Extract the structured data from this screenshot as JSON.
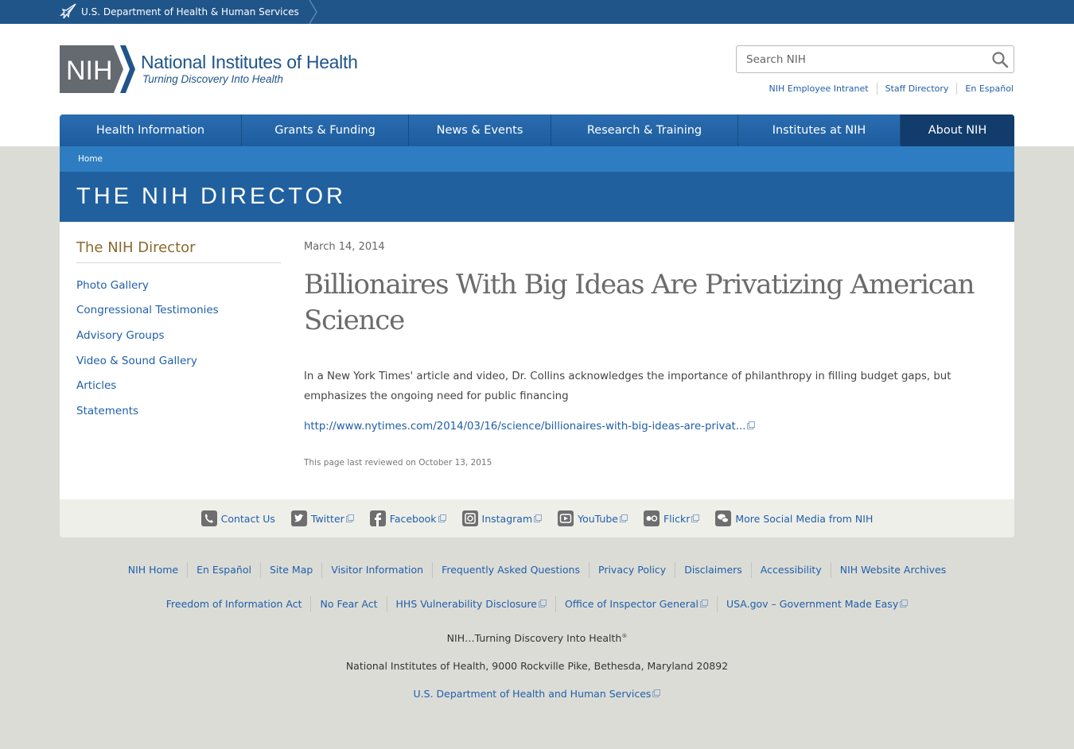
{
  "hhs_bar": {
    "text": "U.S. Department of Health & Human Services"
  },
  "logo": {
    "abbr": "NIH",
    "title": "National Institutes of Health",
    "tagline": "Turning Discovery Into Health"
  },
  "search": {
    "placeholder": "Search NIH"
  },
  "utility_links": [
    "NIH Employee Intranet",
    "Staff Directory",
    "En Español"
  ],
  "main_nav": [
    {
      "label": "Health Information"
    },
    {
      "label": "Grants & Funding"
    },
    {
      "label": "News & Events"
    },
    {
      "label": "Research & Training"
    },
    {
      "label": "Institutes at NIH"
    },
    {
      "label": "About NIH",
      "active": true
    }
  ],
  "breadcrumb": [
    "Home"
  ],
  "page_title": "THE NIH DIRECTOR",
  "sidebar": {
    "title": "The NIH Director",
    "items": [
      "Photo Gallery",
      "Congressional Testimonies",
      "Advisory Groups",
      "Video & Sound Gallery",
      "Articles",
      "Statements"
    ]
  },
  "article": {
    "date": "March 14, 2014",
    "headline": "Billionaires With Big Ideas Are Privatizing American Science",
    "summary": "In a New York Times' article and video, Dr. Collins acknowledges the importance of philanthropy in filling budget gaps, but emphasizes the ongoing need for public financing",
    "link": "http://www.nytimes.com/2014/03/16/science/billionaires-with-big-ideas-are-privat...",
    "reviewed": "This page last reviewed on October 13, 2015"
  },
  "social_links": [
    {
      "label": "Contact Us",
      "icon": "phone-icon",
      "external": false
    },
    {
      "label": "Twitter",
      "icon": "twitter-icon",
      "external": true
    },
    {
      "label": "Facebook",
      "icon": "facebook-icon",
      "external": true
    },
    {
      "label": "Instagram",
      "icon": "instagram-icon",
      "external": true
    },
    {
      "label": "YouTube",
      "icon": "youtube-icon",
      "external": true
    },
    {
      "label": "Flickr",
      "icon": "flickr-icon",
      "external": true
    },
    {
      "label": "More Social Media from NIH",
      "icon": "chat-bubbles-icon",
      "external": false
    }
  ],
  "footer": {
    "row1": [
      {
        "label": "NIH Home",
        "external": false
      },
      {
        "label": "En Español",
        "external": false
      },
      {
        "label": "Site Map",
        "external": false
      },
      {
        "label": "Visitor Information",
        "external": false
      },
      {
        "label": "Frequently Asked Questions",
        "external": false
      },
      {
        "label": "Privacy Policy",
        "external": false
      },
      {
        "label": "Disclaimers",
        "external": false
      },
      {
        "label": "Accessibility",
        "external": false
      },
      {
        "label": "NIH Website Archives",
        "external": false
      }
    ],
    "row2": [
      {
        "label": "Freedom of Information Act",
        "external": false
      },
      {
        "label": "No Fear Act",
        "external": false
      },
      {
        "label": "HHS Vulnerability Disclosure",
        "external": true
      },
      {
        "label": "Office of Inspector General",
        "external": true
      },
      {
        "label": "USA.gov – Government Made Easy",
        "external": true
      }
    ],
    "tagline": "NIH…Turning Discovery Into Health",
    "trademark": "®",
    "address": "National Institutes of Health, 9000 Rockville Pike, Bethesda, Maryland 20892",
    "hhs_link": "U.S. Department of Health and Human Services"
  },
  "colors": {
    "hhs_bar": "#20558a",
    "nav": "#1d5d9e",
    "nav_active": "#113c6b",
    "breadcrumb": "#2e7dc2",
    "title_band": "#20609f",
    "link": "#1f5fa8",
    "sidebar_title": "#8a6a2e"
  }
}
